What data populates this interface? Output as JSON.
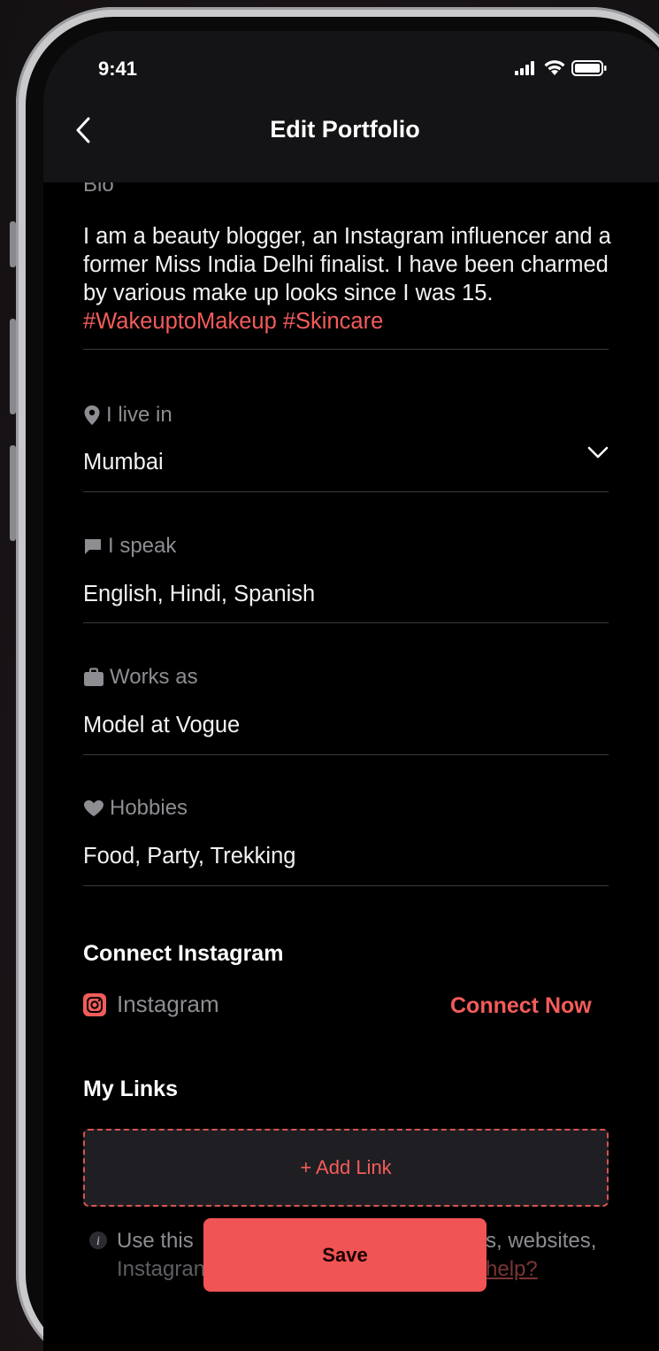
{
  "status_bar": {
    "time": "9:41"
  },
  "header": {
    "title": "Edit Portfolio"
  },
  "bio": {
    "label": "Bio",
    "text": "I am a beauty blogger, an Instagram influencer and a former Miss India Delhi finalist. I have been charmed by various make up looks since I was 15. ",
    "hashtags": "#WakeuptoMakeup #Skincare"
  },
  "location": {
    "label": "I live in",
    "value": "Mumbai"
  },
  "languages": {
    "label": "I speak",
    "value": "English, Hindi, Spanish"
  },
  "work": {
    "label": "Works as",
    "value": "Model at Vogue"
  },
  "hobbies": {
    "label": "Hobbies",
    "value": "Food, Party, Trekking"
  },
  "instagram": {
    "section_title": "Connect Instagram",
    "label": "Instagram",
    "connect_label": "Connect Now"
  },
  "links": {
    "section_title": "My Links",
    "add_label": "+ Add Link",
    "hint_start": "Use this",
    "hint_end": "s, websites,",
    "hint_line2_start": "Instagran",
    "hint_help": "help?"
  },
  "footer": {
    "save_label": "Save"
  },
  "colors": {
    "accent": "#f35c5a",
    "background": "#000000",
    "header": "#141416"
  }
}
